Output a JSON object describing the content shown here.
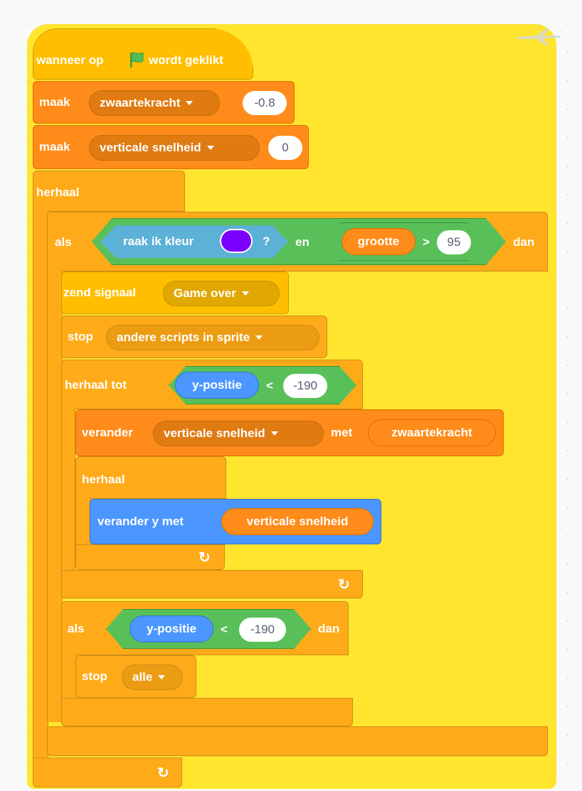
{
  "script": {
    "hat": {
      "prefix": "wanneer op",
      "suffix": "wordt geklikt",
      "flag_icon": "green-flag-icon"
    },
    "set_gravity": {
      "op": "maak",
      "variable": "zwaartekracht",
      "value": "-0.8"
    },
    "set_velocity": {
      "op": "maak",
      "variable": "verticale snelheid",
      "value": "0"
    },
    "forever": {
      "label": "herhaal"
    },
    "if_outer": {
      "label_if": "als",
      "sensing": "raak ik kleur",
      "color": "#7b00ff",
      "question": "?",
      "and": "en",
      "reporter": "grootte",
      "operator": ">",
      "value": "95",
      "label_then": "dan"
    },
    "broadcast": {
      "label": "zend signaal",
      "message": "Game over"
    },
    "stop_other": {
      "label": "stop",
      "option": "andere scripts in sprite"
    },
    "repeat_until": {
      "label": "herhaal tot",
      "reporter": "y-positie",
      "operator": "<",
      "value": "-190"
    },
    "change_velocity": {
      "label": "verander",
      "variable": "verticale snelheid",
      "by": "met",
      "reporter": "zwaartekracht"
    },
    "inner_forever": {
      "label": "herhaal"
    },
    "change_y": {
      "label": "verander y met",
      "reporter": "verticale snelheid"
    },
    "if_bottom": {
      "label_if": "als",
      "reporter": "y-positie",
      "operator": "<",
      "value": "-190",
      "label_then": "dan"
    },
    "stop_all": {
      "label": "stop",
      "option": "alle"
    },
    "loop_arrow": "↻"
  },
  "colors": {
    "control": "#ffab19",
    "variables": "#ff8c1a",
    "operators": "#59c059",
    "sensing": "#5cb1d6",
    "motion": "#4c97ff",
    "events": "#ffbf00",
    "highlight": "#ffe52e"
  }
}
